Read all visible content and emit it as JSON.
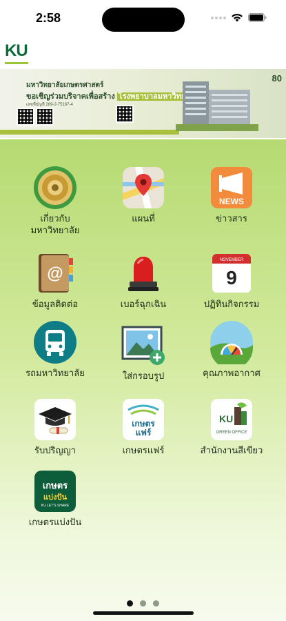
{
  "status_bar": {
    "time": "2:58"
  },
  "header": {
    "logo_text": "KU"
  },
  "banner": {
    "line1": "มหาวิทยาลัยเกษตรศาสตร์",
    "line2_prefix": "ขอเชิญร่วมบริจาคเพื่อสร้าง",
    "line2_highlight": "โรงพยาบาลมหาวิทยาลัยเกษตรศาสตร์",
    "line3": "เลขที่บัญชี 289-2-75167-4",
    "badge": "80"
  },
  "apps": [
    {
      "label": "เกี่ยวกับ\nมหาวิทยาลัย",
      "icon": "university-seal-icon"
    },
    {
      "label": "แผนที่",
      "icon": "map-pin-icon"
    },
    {
      "label": "ข่าวสาร",
      "icon": "news-megaphone-icon",
      "icon_text": "NEWS"
    },
    {
      "label": "ข้อมูลติดต่อ",
      "icon": "address-book-icon"
    },
    {
      "label": "เบอร์ฉุกเฉิน",
      "icon": "siren-icon"
    },
    {
      "label": "ปฏิทินกิจกรรม",
      "icon": "calendar-icon",
      "icon_text_month": "NOVEMBER",
      "icon_text_day": "9"
    },
    {
      "label": "รถมหาวิทยาลัย",
      "icon": "bus-icon"
    },
    {
      "label": "ใส่กรอบรูป",
      "icon": "photo-frame-add-icon"
    },
    {
      "label": "คุณภาพอากาศ",
      "icon": "air-quality-gauge-icon"
    },
    {
      "label": "รับปริญญา",
      "icon": "graduation-cap-icon"
    },
    {
      "label": "เกษตรแฟร์",
      "icon": "kaset-fair-icon",
      "icon_text": "เกษตร\nแฟร์"
    },
    {
      "label": "สำนักงานสีเขียว",
      "icon": "green-office-icon",
      "icon_text": "GREEN OFFICE"
    },
    {
      "label": "เกษตรแบ่งปัน",
      "icon": "kaset-share-icon",
      "icon_text": "เกษตร\nแบ่งปัน",
      "icon_subtext": "KU LET'S SHARE"
    }
  ],
  "pagination": {
    "current": 1,
    "total": 3
  },
  "colors": {
    "brand_green": "#0a6a3a",
    "accent_lime": "#a8c03c",
    "background_top": "#b6da72"
  }
}
